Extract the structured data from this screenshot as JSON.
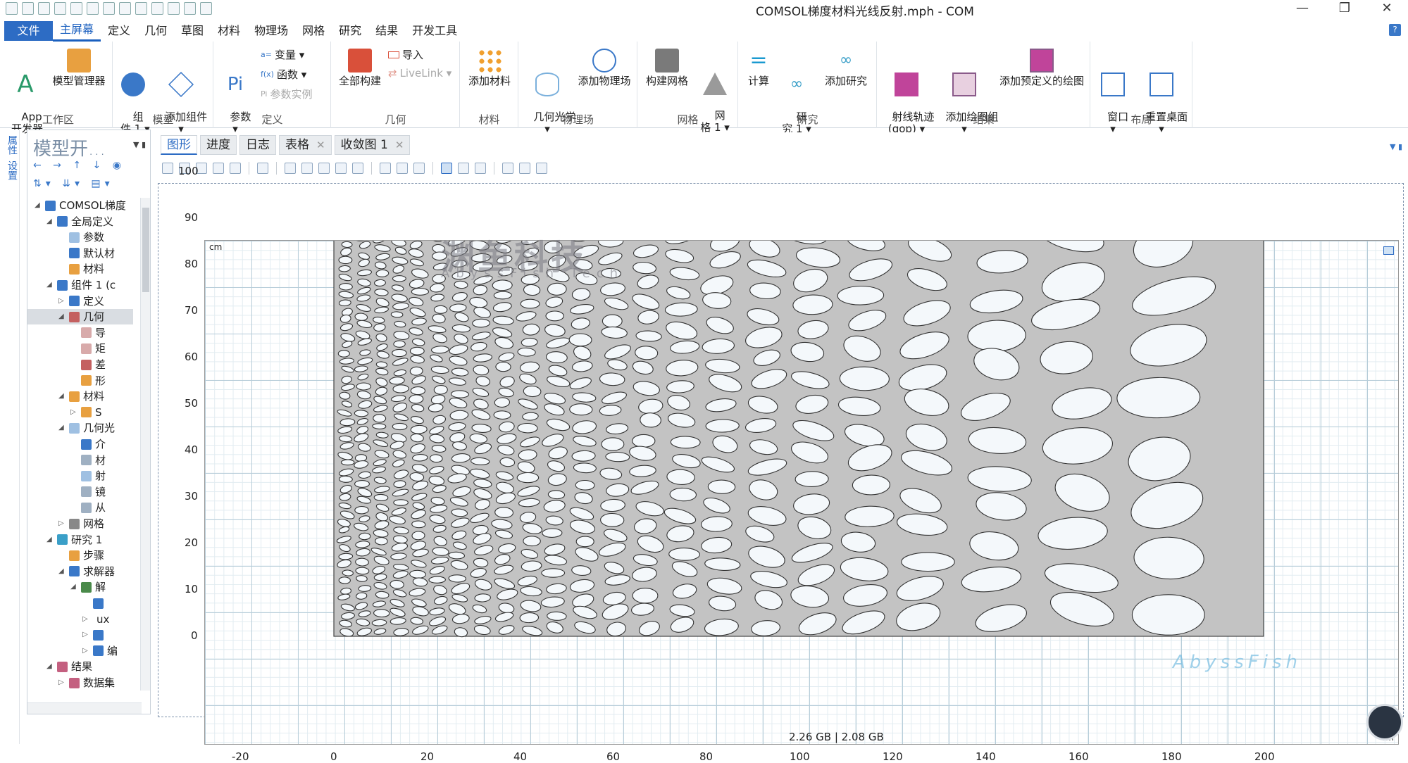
{
  "window": {
    "title": "COMSOL梯度材料光线反射.mph - COM",
    "minimize": "—",
    "maximize": "❐",
    "close": "✕"
  },
  "menu": {
    "file": "文件",
    "items": [
      "主屏幕",
      "定义",
      "几何",
      "草图",
      "材料",
      "物理场",
      "网格",
      "研究",
      "结果",
      "开发工具"
    ],
    "help": "?"
  },
  "ribbon": {
    "workspace": {
      "label": "工作区",
      "app_builder": "App\n开发器",
      "model_manager": "模型管理器"
    },
    "model": {
      "label": "模型",
      "component": "组\n件 1 ▾",
      "add_component": "添加组件\n▾"
    },
    "definitions": {
      "label": "定义",
      "parameters": "参数\n▾",
      "variables": "变量 ▾",
      "functions": "函数 ▾",
      "param_case": "参数实例"
    },
    "geometry": {
      "label": "几何",
      "build_all": "全部构建",
      "import": "导入",
      "livelink": "LiveLink ▾"
    },
    "materials": {
      "label": "材料",
      "add_material": "添加材料"
    },
    "physics": {
      "label": "物理场",
      "ray_optics": "几何光学\n▾",
      "add_physics": "添加物理场"
    },
    "mesh": {
      "label": "网格",
      "build_mesh": "构建网格",
      "mesh1": "网\n格 1 ▾"
    },
    "study": {
      "label": "研究",
      "compute": "计算",
      "study1": "研\n究 1 ▾",
      "add_study": "添加研究"
    },
    "results": {
      "label": "结果",
      "ray_traj": "射线轨迹\n(gop) ▾",
      "add_plot_group": "添加绘图组\n▾",
      "add_predef": "添加预定义的绘图"
    },
    "layout": {
      "label": "布局",
      "windows": "窗口\n▾",
      "reset_desktop": "重置桌面\n▾"
    }
  },
  "side_strip": {
    "properties": "属性",
    "settings": "设置"
  },
  "model_builder": {
    "title": "模型开...",
    "tree": [
      {
        "label": "COMSOL梯度",
        "indent": 0,
        "exp": "◢",
        "icon": "#3a78c8"
      },
      {
        "label": "全局定义",
        "indent": 1,
        "exp": "◢",
        "icon": "#3a78c8"
      },
      {
        "label": "参数",
        "indent": 2,
        "exp": "",
        "icon": "#9fc0e2"
      },
      {
        "label": "默认材",
        "indent": 2,
        "exp": "",
        "icon": "#3a78c8"
      },
      {
        "label": "材料",
        "indent": 2,
        "exp": "",
        "icon": "#e8a040"
      },
      {
        "label": "组件 1 (c",
        "indent": 1,
        "exp": "◢",
        "icon": "#3a78c8"
      },
      {
        "label": "定义",
        "indent": 2,
        "exp": "▷",
        "icon": "#3a78c8"
      },
      {
        "label": "几何",
        "indent": 2,
        "exp": "◢",
        "icon": "#c46060",
        "sel": true
      },
      {
        "label": "导",
        "indent": 3,
        "exp": "",
        "icon": "#d8aaaa"
      },
      {
        "label": "矩",
        "indent": 3,
        "exp": "",
        "icon": "#d8aaaa"
      },
      {
        "label": "差",
        "indent": 3,
        "exp": "",
        "icon": "#c46060"
      },
      {
        "label": "形",
        "indent": 3,
        "exp": "",
        "icon": "#e8a040"
      },
      {
        "label": "材料",
        "indent": 2,
        "exp": "◢",
        "icon": "#e8a040"
      },
      {
        "label": "S",
        "indent": 3,
        "exp": "▷",
        "icon": "#e8a040"
      },
      {
        "label": "几何光",
        "indent": 2,
        "exp": "◢",
        "icon": "#9fc0e2"
      },
      {
        "label": "介",
        "indent": 3,
        "exp": "",
        "icon": "#3a78c8"
      },
      {
        "label": "材",
        "indent": 3,
        "exp": "",
        "icon": "#9fb0c2"
      },
      {
        "label": "射",
        "indent": 3,
        "exp": "",
        "icon": "#9fc0e2"
      },
      {
        "label": "镜",
        "indent": 3,
        "exp": "",
        "icon": "#9fb0c2"
      },
      {
        "label": "从",
        "indent": 3,
        "exp": "",
        "icon": "#9fb0c2"
      },
      {
        "label": "网格",
        "indent": 2,
        "exp": "▷",
        "icon": "#888888"
      },
      {
        "label": "研究 1",
        "indent": 1,
        "exp": "◢",
        "icon": "#3a9fc8"
      },
      {
        "label": "步骤",
        "indent": 2,
        "exp": "",
        "icon": "#e8a040"
      },
      {
        "label": "求解器",
        "indent": 2,
        "exp": "◢",
        "icon": "#3a78c8"
      },
      {
        "label": "解",
        "indent": 3,
        "exp": "◢",
        "icon": "#4a8a4a"
      },
      {
        "label": "",
        "indent": 4,
        "exp": "",
        "icon": "#3a78c8"
      },
      {
        "label": "ux",
        "indent": 4,
        "exp": "▷",
        "icon": ""
      },
      {
        "label": "",
        "indent": 4,
        "exp": "▷",
        "icon": "#3a78c8"
      },
      {
        "label": "编",
        "indent": 4,
        "exp": "▷",
        "icon": "#3a78c8"
      },
      {
        "label": "结果",
        "indent": 1,
        "exp": "◢",
        "icon": "#c46080"
      },
      {
        "label": "数据集",
        "indent": 2,
        "exp": "▷",
        "icon": "#c46080"
      }
    ]
  },
  "graphics": {
    "tabs": [
      {
        "label": "图形",
        "active": true
      },
      {
        "label": "进度"
      },
      {
        "label": "日志"
      },
      {
        "label": "表格",
        "close": "✕"
      },
      {
        "label": "收敛图 1",
        "close": "✕"
      }
    ],
    "unit": "cm",
    "x_ticks": [
      "-20",
      "0",
      "20",
      "40",
      "60",
      "80",
      "100",
      "120",
      "140",
      "160",
      "180",
      "200"
    ],
    "y_ticks": [
      "100",
      "90",
      "80",
      "70",
      "60",
      "50",
      "40",
      "30",
      "20",
      "10",
      "0"
    ],
    "watermark_cn": "渊鱼科技",
    "watermark_en": "AbyssFish Tech",
    "watermark_br": "AbyssFish"
  },
  "status": {
    "memory": "2.26 GB | 2.08 GB"
  },
  "colors": {
    "accent": "#2d6cc4",
    "domain_fill": "#c3c3c3",
    "hole_fill": "#f4f8fb"
  }
}
